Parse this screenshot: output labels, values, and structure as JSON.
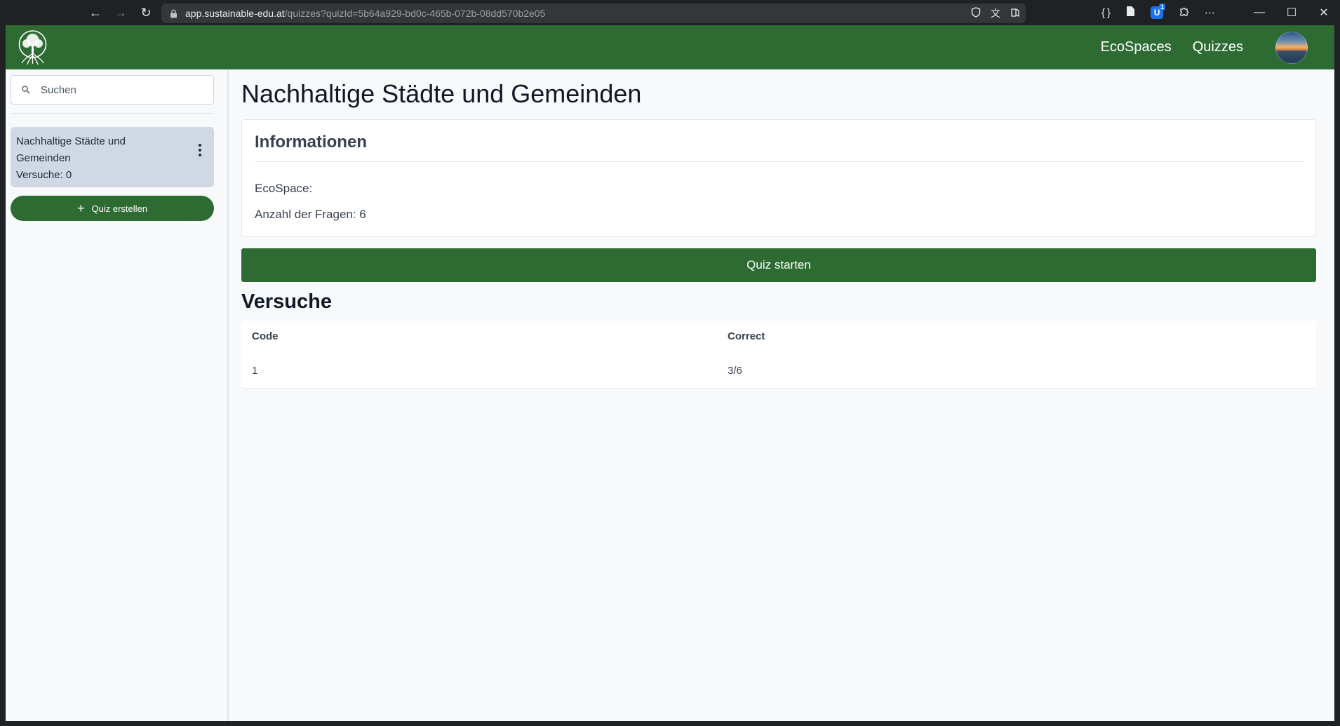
{
  "browser": {
    "url_host": "app.sustainable-edu.at",
    "url_path": "/quizzes?quizId=5b64a929-bd0c-465b-072b-08dd570b2e05",
    "extension_badge": "1"
  },
  "header": {
    "nav": [
      "EcoSpaces",
      "Quizzes"
    ]
  },
  "sidebar": {
    "search_placeholder": "Suchen",
    "quizzes": [
      {
        "title": "Nachhaltige Städte und Gemeinden",
        "attempts": "Versuche: 0"
      }
    ],
    "create_label": "Quiz erstellen"
  },
  "main": {
    "title": "Nachhaltige Städte und Gemeinden",
    "info": {
      "heading": "Informationen",
      "ecospace": "EcoSpace:",
      "question_count": "Anzahl der Fragen: 6"
    },
    "start_label": "Quiz starten",
    "attempts_heading": "Versuche",
    "table": {
      "columns": [
        "Code",
        "Correct"
      ],
      "rows": [
        [
          "1",
          "3/6"
        ]
      ]
    }
  },
  "colors": {
    "primary": "#2e6b33",
    "selected_item": "#cfd8e3"
  }
}
